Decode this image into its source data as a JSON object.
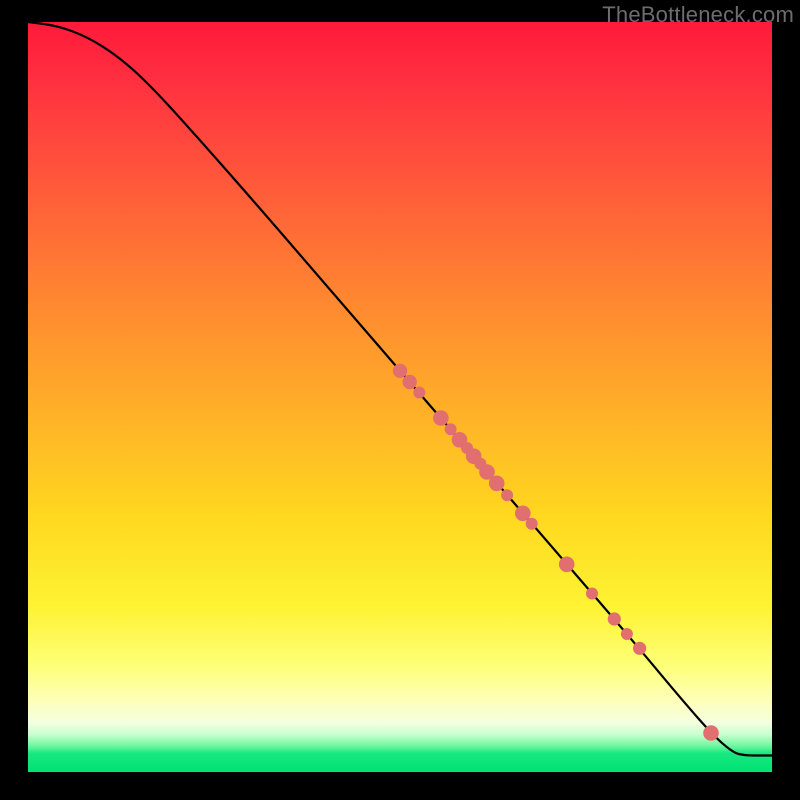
{
  "watermark": "TheBottleneck.com",
  "colors": {
    "dot": "#e26f6f",
    "curve": "#000000",
    "frame_bg": "#000000"
  },
  "chart_data": {
    "type": "line",
    "title": "",
    "xlabel": "",
    "ylabel": "",
    "xlim": [
      0,
      100
    ],
    "ylim": [
      0,
      100
    ],
    "grid": false,
    "legend": false,
    "note": "Monotonically decreasing curve over a red→yellow→green vertical gradient; scatter points lie on the curve. Axes have no visible ticks/labels so x,y are in 0–100 plot-area percent.",
    "curve": [
      {
        "x": 0.0,
        "y": 100.0
      },
      {
        "x": 4.0,
        "y": 99.5
      },
      {
        "x": 8.0,
        "y": 98.0
      },
      {
        "x": 12.0,
        "y": 95.5
      },
      {
        "x": 16.0,
        "y": 92.0
      },
      {
        "x": 22.0,
        "y": 85.5
      },
      {
        "x": 30.0,
        "y": 76.5
      },
      {
        "x": 40.0,
        "y": 65.0
      },
      {
        "x": 50.0,
        "y": 53.5
      },
      {
        "x": 60.0,
        "y": 42.0
      },
      {
        "x": 70.0,
        "y": 30.5
      },
      {
        "x": 80.0,
        "y": 19.0
      },
      {
        "x": 88.0,
        "y": 9.5
      },
      {
        "x": 92.0,
        "y": 5.0
      },
      {
        "x": 94.5,
        "y": 2.8
      },
      {
        "x": 96.0,
        "y": 2.2
      },
      {
        "x": 100.0,
        "y": 2.2
      }
    ],
    "points": [
      {
        "x": 50.0,
        "y": 53.5,
        "r": 1.2
      },
      {
        "x": 51.3,
        "y": 52.0,
        "r": 1.2
      },
      {
        "x": 52.6,
        "y": 50.6,
        "r": 1.0
      },
      {
        "x": 55.5,
        "y": 47.2,
        "r": 1.3
      },
      {
        "x": 56.8,
        "y": 45.7,
        "r": 1.0
      },
      {
        "x": 58.0,
        "y": 44.3,
        "r": 1.3
      },
      {
        "x": 59.0,
        "y": 43.2,
        "r": 1.0
      },
      {
        "x": 59.9,
        "y": 42.1,
        "r": 1.3
      },
      {
        "x": 60.8,
        "y": 41.1,
        "r": 1.0
      },
      {
        "x": 61.7,
        "y": 40.0,
        "r": 1.3
      },
      {
        "x": 63.0,
        "y": 38.5,
        "r": 1.3
      },
      {
        "x": 64.4,
        "y": 36.9,
        "r": 1.0
      },
      {
        "x": 66.5,
        "y": 34.5,
        "r": 1.3
      },
      {
        "x": 67.7,
        "y": 33.1,
        "r": 1.0
      },
      {
        "x": 72.4,
        "y": 27.7,
        "r": 1.3
      },
      {
        "x": 75.8,
        "y": 23.8,
        "r": 1.0
      },
      {
        "x": 78.8,
        "y": 20.4,
        "r": 1.1
      },
      {
        "x": 80.5,
        "y": 18.4,
        "r": 1.0
      },
      {
        "x": 82.2,
        "y": 16.5,
        "r": 1.1
      },
      {
        "x": 91.8,
        "y": 5.2,
        "r": 1.3
      }
    ]
  }
}
